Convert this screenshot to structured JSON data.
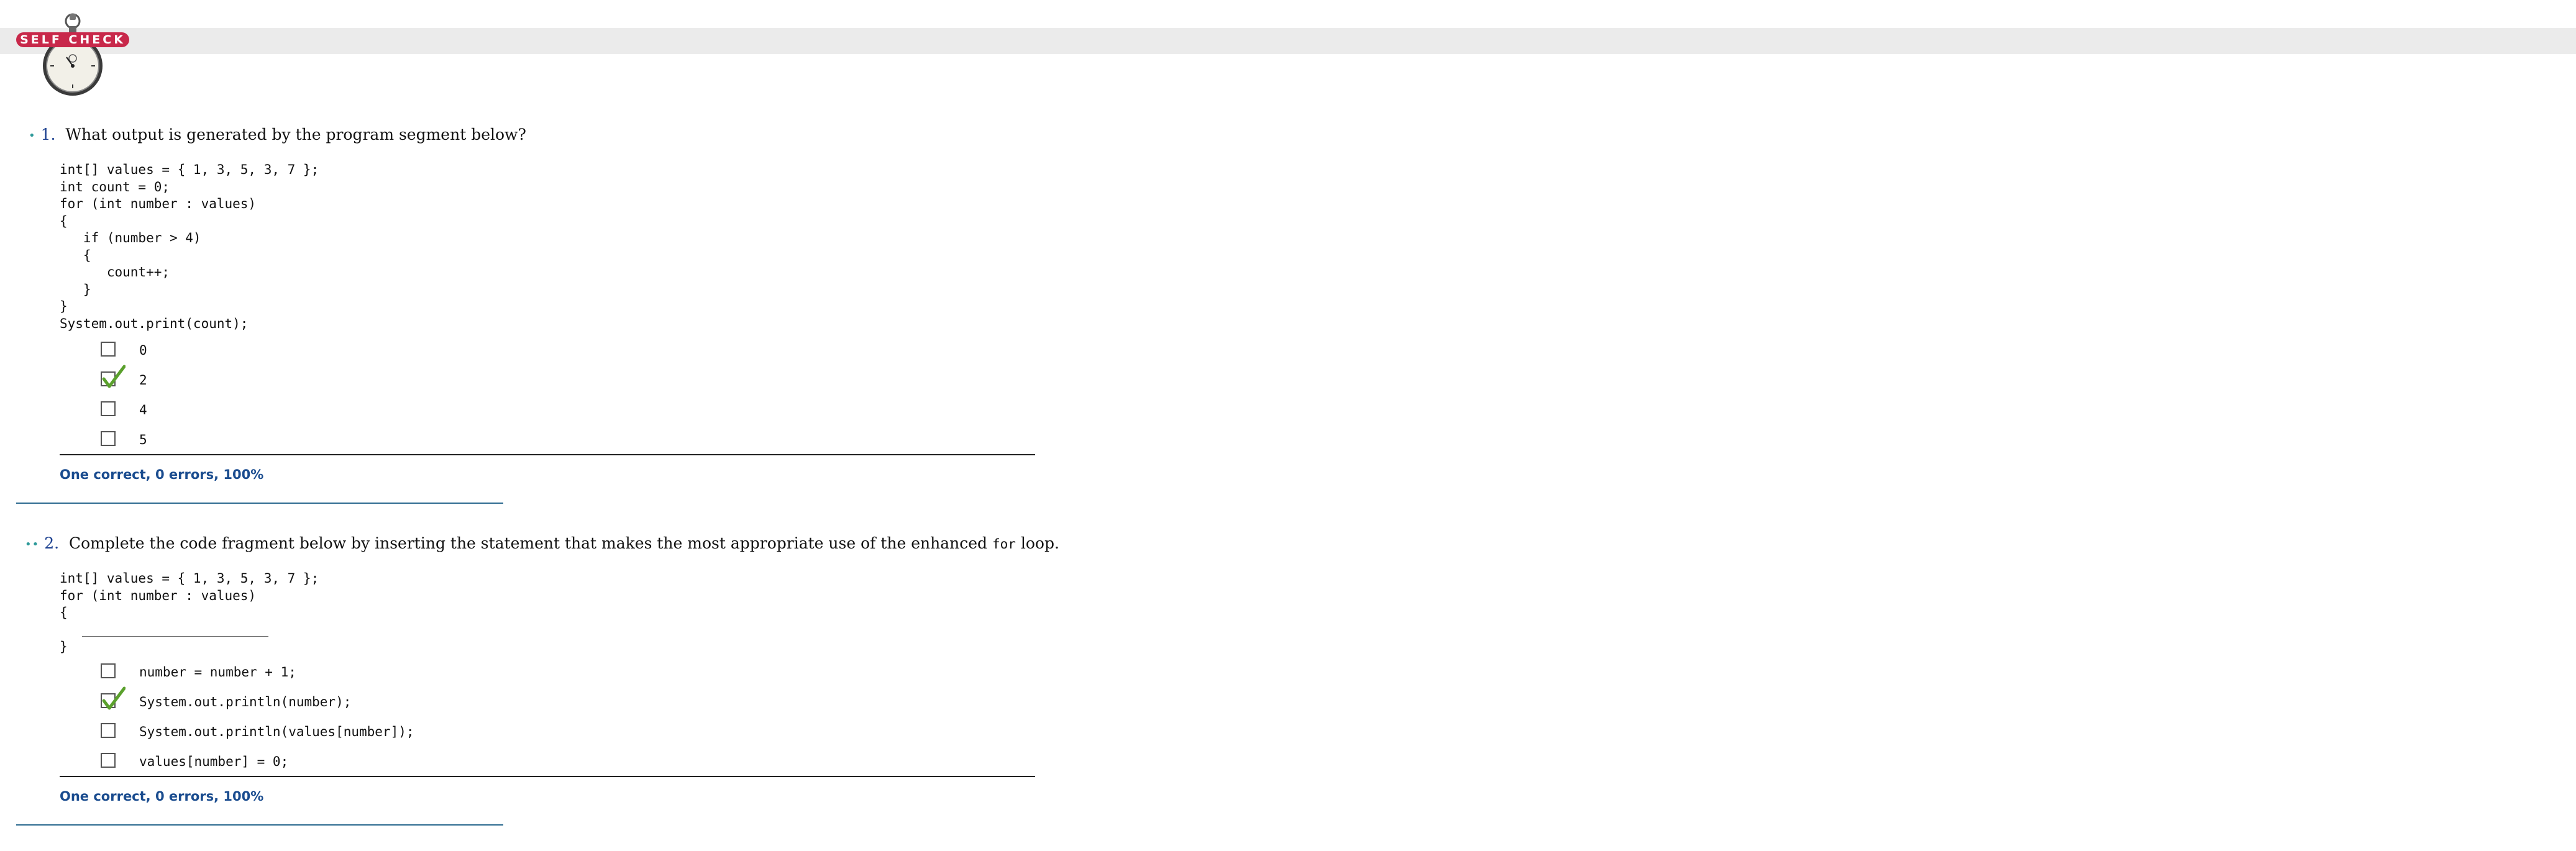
{
  "header": {
    "badge_text": "SELF CHECK"
  },
  "questions": [
    {
      "dots": "•",
      "number": "1.",
      "prompt": "What output is generated by the program segment below?",
      "code": "int[] values = { 1, 3, 5, 3, 7 };\nint count = 0;\nfor (int number : values)\n{\n   if (number > 4)\n   {\n      count++;\n   }\n}\nSystem.out.print(count);",
      "options": [
        {
          "label": "0",
          "checked": false
        },
        {
          "label": "2",
          "checked": true
        },
        {
          "label": "4",
          "checked": false
        },
        {
          "label": "5",
          "checked": false
        }
      ],
      "result": "One correct, 0 errors, 100%"
    },
    {
      "dots": "••",
      "number": "2.",
      "prompt_before": "Complete the code fragment below by inserting the statement that makes the most appropriate use of the enhanced ",
      "prompt_code": "for",
      "prompt_after": " loop.",
      "code_top": "int[] values = { 1, 3, 5, 3, 7 };\nfor (int number : values)\n{",
      "code_bottom": "}",
      "options": [
        {
          "label": "number = number + 1;",
          "checked": false
        },
        {
          "label": "System.out.println(number);",
          "checked": true
        },
        {
          "label": "System.out.println(values[number]);",
          "checked": false
        },
        {
          "label": "values[number] = 0;",
          "checked": false
        }
      ],
      "result": "One correct, 0 errors, 100%"
    }
  ],
  "colors": {
    "badge": "#c8284a",
    "result_text": "#1a4c8f",
    "bullet": "#2e9a9a",
    "check": "#5aa02c"
  }
}
